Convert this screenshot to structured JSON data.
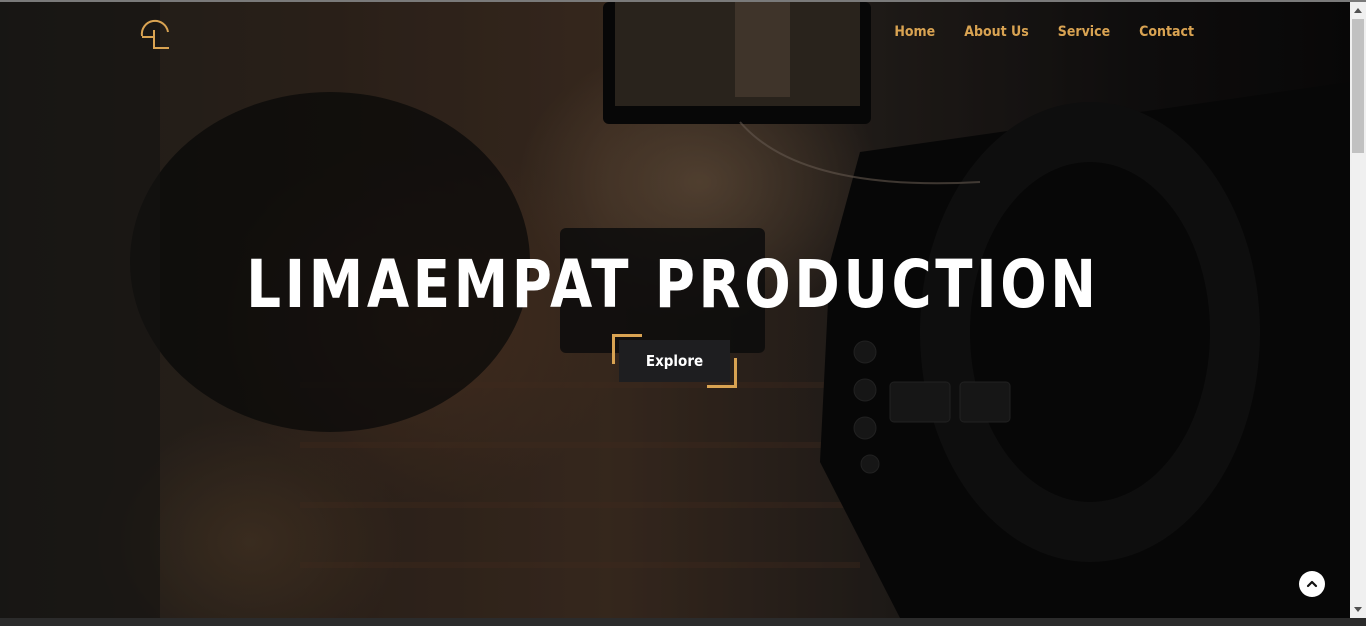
{
  "nav": {
    "items": [
      {
        "label": "Home"
      },
      {
        "label": "About Us"
      },
      {
        "label": "Service"
      },
      {
        "label": "Contact"
      }
    ]
  },
  "hero": {
    "title": "LIMAEMPAT PRODUCTION",
    "cta_label": "Explore"
  },
  "icons": {
    "logo": "logo-mark-icon",
    "scroll_top": "chevron-up-icon"
  },
  "colors": {
    "accent": "#d9a352",
    "button_bg": "#1e1e20",
    "title": "#ffffff"
  }
}
